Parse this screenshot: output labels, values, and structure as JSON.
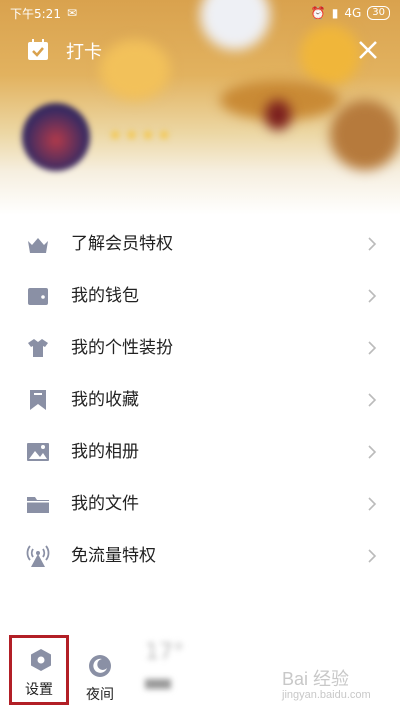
{
  "status_bar": {
    "time": "下午5:21",
    "network": "4G",
    "battery": "30"
  },
  "topbar": {
    "title": "打卡",
    "checkin_icon": "calendar-check-icon",
    "close_icon": "close-icon"
  },
  "menu": {
    "items": [
      {
        "label": "了解会员特权",
        "icon": "crown-icon"
      },
      {
        "label": "我的钱包",
        "icon": "wallet-icon"
      },
      {
        "label": "我的个性装扮",
        "icon": "shirt-icon"
      },
      {
        "label": "我的收藏",
        "icon": "bookmark-icon"
      },
      {
        "label": "我的相册",
        "icon": "image-icon"
      },
      {
        "label": "我的文件",
        "icon": "folder-icon"
      },
      {
        "label": "免流量特权",
        "icon": "signal-tower-icon"
      }
    ]
  },
  "bottom": {
    "settings_label": "设置",
    "night_label": "夜间"
  },
  "watermark": {
    "text": "Bai 经验",
    "sub": "jingyan.baidu.com"
  },
  "colors": {
    "icon_gray": "#8a90a5",
    "highlight_border": "#b21f26",
    "text": "#222222"
  }
}
